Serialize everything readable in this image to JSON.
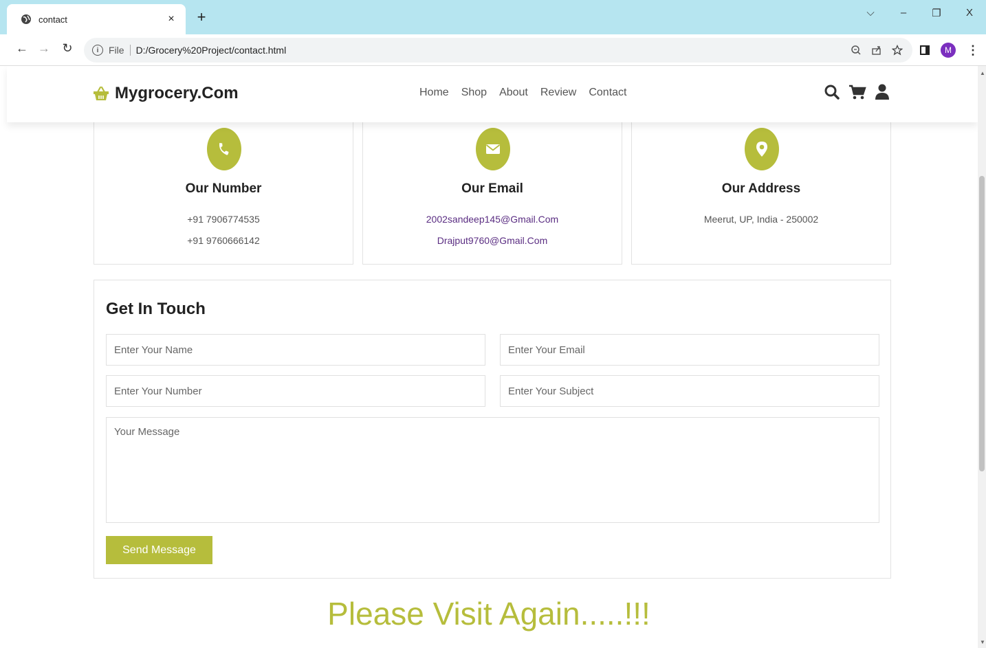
{
  "browser": {
    "tab_title": "contact",
    "tab_close": "×",
    "new_tab": "+",
    "file_label": "File",
    "url": "D:/Grocery%20Project/contact.html",
    "avatar_letter": "M",
    "win_minimize": "–",
    "win_restore": "❐",
    "win_close": "X",
    "win_dropdown": "⌵"
  },
  "header": {
    "logo_text": "Mygrocery.Com",
    "nav": [
      "Home",
      "Shop",
      "About",
      "Review",
      "Contact"
    ]
  },
  "cards": [
    {
      "title": "Our Number",
      "lines": [
        "+91 7906774535",
        "+91 9760666142"
      ],
      "icon": "phone-icon"
    },
    {
      "title": "Our Email",
      "lines": [
        "2002sandeep145@Gmail.Com",
        "Drajput9760@Gmail.Com"
      ],
      "icon": "envelope-icon"
    },
    {
      "title": "Our Address",
      "lines": [
        "Meerut, UP, India - 250002"
      ],
      "icon": "map-marker-icon"
    }
  ],
  "form": {
    "title": "Get In Touch",
    "name_placeholder": "Enter Your Name",
    "email_placeholder": "Enter Your Email",
    "number_placeholder": "Enter Your Number",
    "subject_placeholder": "Enter Your Subject",
    "message_placeholder": "Your Message",
    "send_label": "Send Message"
  },
  "farewell": "Please Visit Again.....!!!",
  "colors": {
    "accent": "#b6bd3c",
    "tabbar": "#b6e5f0",
    "link": "#5a2d82"
  }
}
